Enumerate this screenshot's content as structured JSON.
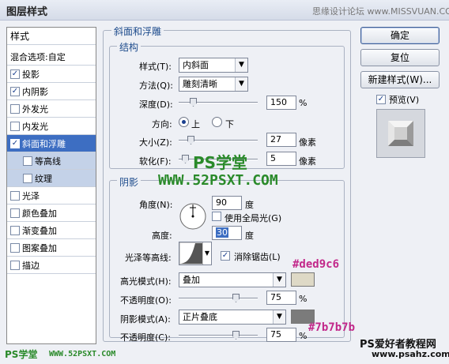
{
  "window": {
    "title": "图层样式",
    "watermark": "思缘设计论坛  www.MISSVUAN.COM"
  },
  "left_panel": {
    "styles_label": "样式",
    "blend_options": "混合选项:自定",
    "items": [
      {
        "label": "投影",
        "checked": true
      },
      {
        "label": "内阴影",
        "checked": true
      },
      {
        "label": "外发光",
        "checked": false
      },
      {
        "label": "内发光",
        "checked": false
      },
      {
        "label": "斜面和浮雕",
        "checked": true,
        "active": true
      },
      {
        "label": "等高线",
        "checked": false,
        "sub": true
      },
      {
        "label": "纹理",
        "checked": false,
        "sub": true
      },
      {
        "label": "光泽",
        "checked": false
      },
      {
        "label": "颜色叠加",
        "checked": false
      },
      {
        "label": "渐变叠加",
        "checked": false
      },
      {
        "label": "图案叠加",
        "checked": false
      },
      {
        "label": "描边",
        "checked": false
      }
    ],
    "check_glyph": "✓"
  },
  "bevel": {
    "title": "斜面和浮雕",
    "structure_title": "结构",
    "style_label": "样式(T):",
    "style_value": "内斜面",
    "technique_label": "方法(Q):",
    "technique_value": "雕刻清晰",
    "depth_label": "深度(D):",
    "depth_value": "150",
    "depth_unit": "%",
    "depth_slider": 0.15,
    "direction_label": "方向:",
    "dir_up": "上",
    "dir_down": "下",
    "size_label": "大小(Z):",
    "size_value": "27",
    "size_unit": "像素",
    "size_slider": 0.12,
    "soften_label": "软化(F):",
    "soften_value": "5",
    "soften_unit": "像素",
    "soften_slider": 0.04
  },
  "shading": {
    "title": "阴影",
    "angle_label": "角度(N):",
    "angle_value": "90",
    "angle_unit": "度",
    "global_light_label": "使用全局光(G)",
    "altitude_label": "高度:",
    "altitude_value": "30",
    "altitude_unit": "度",
    "gloss_label": "光泽等高线:",
    "anti_alias_label": "消除锯齿(L)",
    "highlight_mode_label": "高光模式(H):",
    "highlight_mode_value": "叠加",
    "highlight_color": "#ded9c6",
    "highlight_opacity_label": "不透明度(O):",
    "highlight_opacity_value": "75",
    "highlight_opacity": 0.75,
    "shadow_mode_label": "阴影模式(A):",
    "shadow_mode_value": "正片叠底",
    "shadow_color": "#7b7b7b",
    "shadow_opacity_label": "不透明度(C):",
    "shadow_opacity_value": "75",
    "shadow_opacity": 0.75,
    "percent": "%"
  },
  "buttons": {
    "ok": "确定",
    "reset": "复位",
    "new_style": "新建样式(W)...",
    "preview_label": "预览(V)"
  },
  "overlays": {
    "ps_school": "PS学堂",
    "url": "WWW.52PSXT.COM",
    "hex_highlight": "#ded9c6",
    "hex_shadow": "#7b7b7b",
    "site_name": "PS爱好者教程网",
    "site_url": "www.psahz.com",
    "footer_logo": "PS学堂",
    "footer_url": "WWW.52PSXT.COM"
  },
  "colors": {
    "accent": "#3d6ec2",
    "overlay_green": "#2a8a2a",
    "overlay_purple": "#c2288a"
  },
  "icons": {
    "dropdown": "chevron-down-icon",
    "angle_dial": "angle-dial-icon",
    "contour": "contour-curve-icon",
    "preview": "bevel-preview-icon"
  }
}
